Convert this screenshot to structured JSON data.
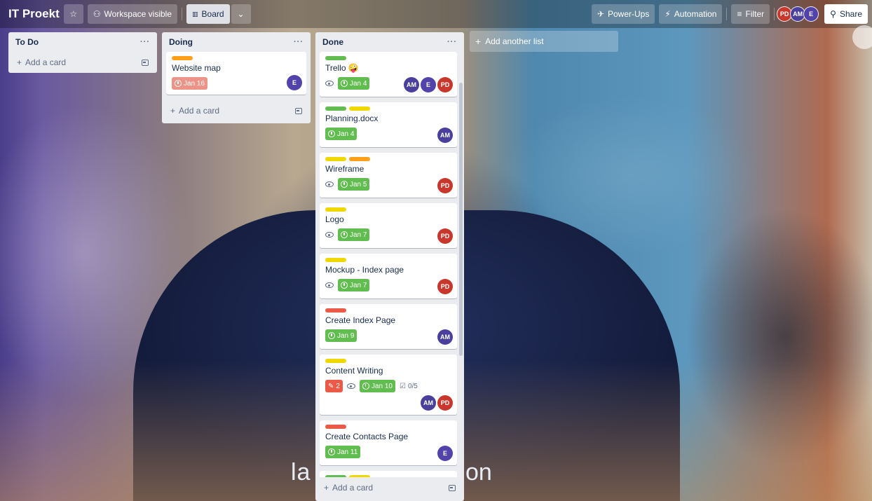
{
  "header": {
    "title": "IT Proekt",
    "workspace_visible": "Workspace visible",
    "board_view": "Board",
    "power_ups": "Power-Ups",
    "automation": "Automation",
    "filter": "Filter",
    "share": "Share",
    "members": [
      "PD",
      "AM",
      "E"
    ]
  },
  "lists": {
    "todo": {
      "title": "To Do",
      "add_card": "Add a card"
    },
    "doing": {
      "title": "Doing",
      "add_card": "Add a card",
      "cards": [
        {
          "title": "Website map",
          "due": "Jan 16",
          "members": [
            "E"
          ]
        }
      ]
    },
    "done": {
      "title": "Done",
      "add_card": "Add a card",
      "cards": [
        {
          "title": "Trello 🤪",
          "due": "Jan 4",
          "members": [
            "AM",
            "E",
            "PD"
          ]
        },
        {
          "title": "Planning.docx",
          "due": "Jan 4",
          "members": [
            "AM"
          ]
        },
        {
          "title": "Wireframe",
          "due": "Jan 5",
          "members": [
            "PD"
          ]
        },
        {
          "title": "Logo",
          "due": "Jan 7",
          "members": [
            "PD"
          ]
        },
        {
          "title": "Mockup - Index page",
          "due": "Jan 7",
          "members": [
            "PD"
          ]
        },
        {
          "title": "Create Index Page",
          "due": "Jan 9",
          "members": [
            "AM"
          ]
        },
        {
          "title": "Content Writing",
          "attachments": "2",
          "due": "Jan 10",
          "checklist": "0/5",
          "members": [
            "AM",
            "PD"
          ]
        },
        {
          "title": "Create Contacts Page",
          "due": "Jan 11",
          "members": [
            "E"
          ]
        }
      ]
    }
  },
  "add_another_list": "Add another list",
  "background_text": {
    "left": "la",
    "right": "on"
  },
  "colors": {
    "label_green": "#61bd4f",
    "label_yellow": "#f2d600",
    "label_orange": "#ff9f1a",
    "label_red": "#eb5a46",
    "avatar_pd": "#c9372c",
    "avatar_am": "#4b3f9e",
    "avatar_e": "#5243aa"
  }
}
